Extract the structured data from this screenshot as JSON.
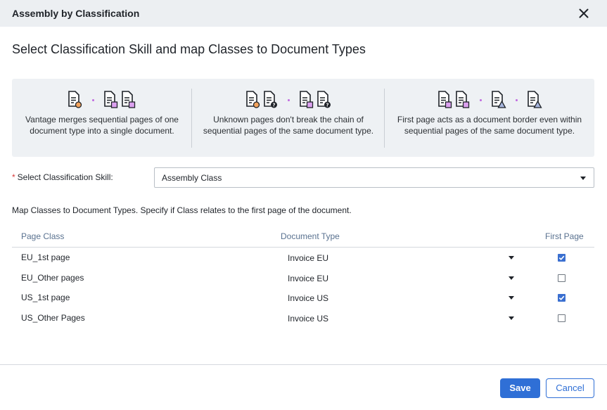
{
  "dialog": {
    "title": "Assembly by Classification",
    "heading": "Select Classification Skill and map Classes to Document Types"
  },
  "info": {
    "columns": [
      {
        "line1": "Vantage merges sequential pages of one",
        "line2": "document type into a single document.",
        "icons": [
          "page-circle-icon",
          "page-square-icon",
          "page-square-icon"
        ]
      },
      {
        "line1": "Unknown pages don't break the chain of",
        "line2": "sequential pages of the same document type.",
        "icons": [
          "page-circle-icon",
          "page-question-icon",
          "page-square-icon",
          "page-question-icon"
        ]
      },
      {
        "line1": "First page acts as a document border even within",
        "line2": "sequential pages of the same document type.",
        "icons": [
          "page-square-icon",
          "page-square-icon",
          "page-triangle-icon",
          "page-triangle-icon"
        ]
      }
    ],
    "colors": {
      "circle": "#f3a35c",
      "square": "#dca1f0",
      "triangle": "#a7b6de",
      "dot": "#c06ae0"
    }
  },
  "skill": {
    "required_marker": "*",
    "label": "Select Classification Skill:",
    "value": "Assembly Class"
  },
  "mapping": {
    "instructions": "Map Classes to Document Types. Specify if Class relates to the first page of the document.",
    "columns": {
      "page_class": "Page Class",
      "document_type": "Document Type",
      "first_page": "First Page"
    },
    "rows": [
      {
        "page_class": "EU_1st page",
        "document_type": "Invoice EU",
        "first_page": true
      },
      {
        "page_class": "EU_Other pages",
        "document_type": "Invoice EU",
        "first_page": false
      },
      {
        "page_class": "US_1st page",
        "document_type": "Invoice US",
        "first_page": true
      },
      {
        "page_class": "US_Other Pages",
        "document_type": "Invoice US",
        "first_page": false
      }
    ]
  },
  "footer": {
    "save_label": "Save",
    "cancel_label": "Cancel"
  },
  "theme": {
    "accent": "#2f6fd6",
    "header_bg": "#eceff2",
    "panel_bg": "#eef1f4"
  }
}
